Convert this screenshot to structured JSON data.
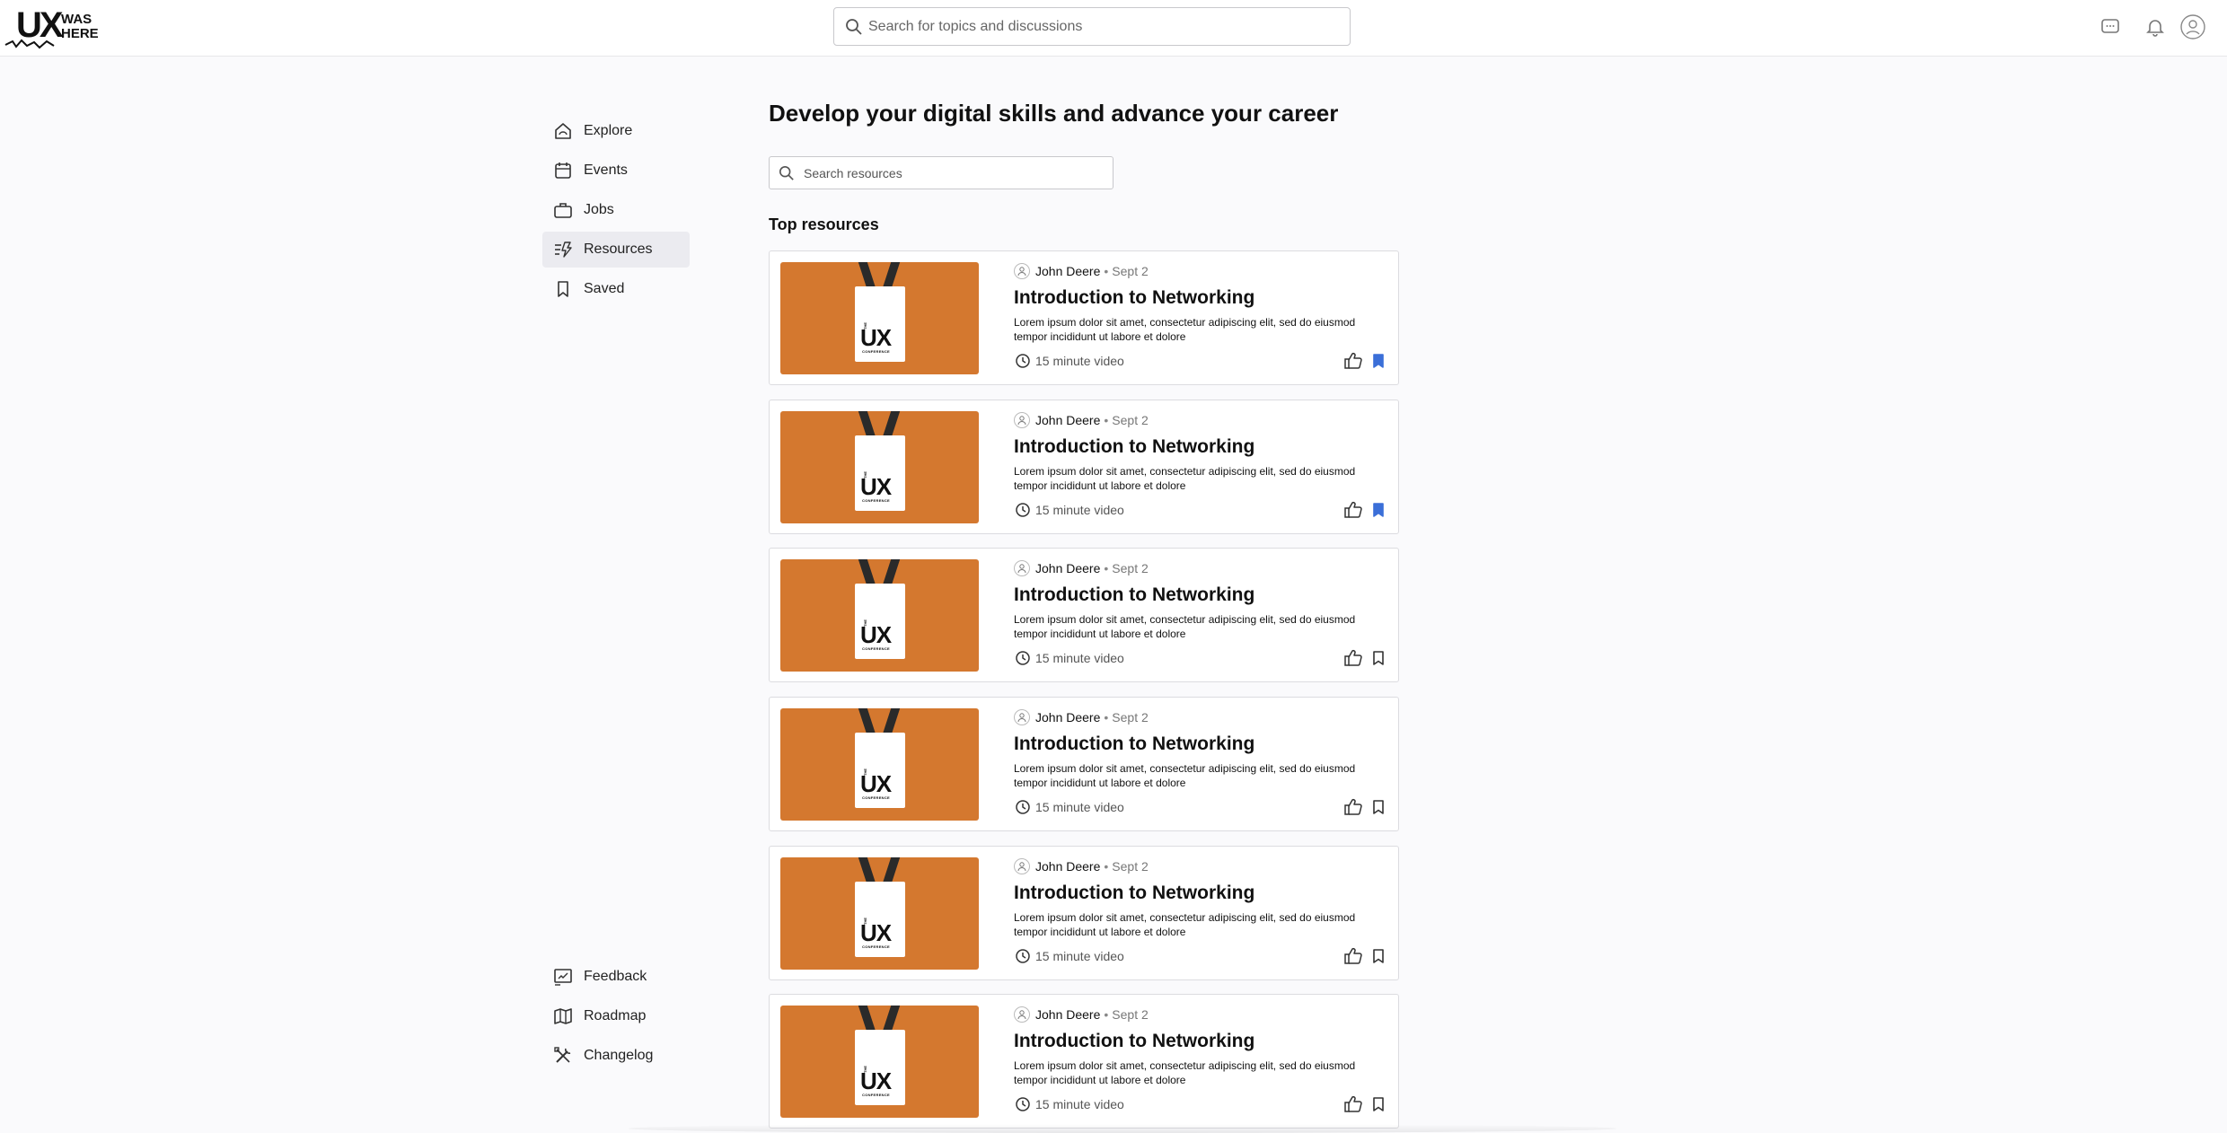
{
  "brand": {
    "logo_text_main": "UX",
    "logo_text_top": "WAS",
    "logo_text_bottom": "HERE"
  },
  "header": {
    "search_placeholder": "Search for topics and discussions",
    "icons": [
      "chat-icon",
      "bell-icon",
      "user-icon"
    ]
  },
  "sidebar": {
    "items": [
      {
        "label": "Explore",
        "icon": "home-icon"
      },
      {
        "label": "Events",
        "icon": "calendar-icon"
      },
      {
        "label": "Jobs",
        "icon": "briefcase-icon"
      },
      {
        "label": "Resources",
        "icon": "resources-icon",
        "active": true
      },
      {
        "label": "Saved",
        "icon": "bookmark-icon"
      }
    ],
    "bottom_items": [
      {
        "label": "Feedback",
        "icon": "feedback-icon"
      },
      {
        "label": "Roadmap",
        "icon": "map-icon"
      },
      {
        "label": "Changelog",
        "icon": "tools-icon"
      }
    ]
  },
  "main": {
    "title": "Develop your digital skills and advance your career",
    "search_placeholder": "Search resources",
    "section_title": "Top resources",
    "cards": [
      {
        "author": "John Deere",
        "date": "Sept 2",
        "title": "Introduction to Networking",
        "description": "Lorem ipsum dolor sit amet, consectetur adipiscing elit, sed do eiusmod tempor incididunt ut labore et dolore",
        "duration": "15 minute video",
        "saved": true,
        "thumb": {
          "top": "THE",
          "main": "UX",
          "bottom": "CONFERENCE"
        }
      },
      {
        "author": "John Deere",
        "date": "Sept 2",
        "title": "Introduction to Networking",
        "description": "Lorem ipsum dolor sit amet, consectetur adipiscing elit, sed do eiusmod tempor incididunt ut labore et dolore",
        "duration": "15 minute video",
        "saved": true,
        "thumb": {
          "top": "THE",
          "main": "UX",
          "bottom": "CONFERENCE"
        }
      },
      {
        "author": "John Deere",
        "date": "Sept 2",
        "title": "Introduction to Networking",
        "description": "Lorem ipsum dolor sit amet, consectetur adipiscing elit, sed do eiusmod tempor incididunt ut labore et dolore",
        "duration": "15 minute video",
        "saved": false,
        "thumb": {
          "top": "THE",
          "main": "UX",
          "bottom": "CONFERENCE"
        }
      },
      {
        "author": "John Deere",
        "date": "Sept 2",
        "title": "Introduction to Networking",
        "description": "Lorem ipsum dolor sit amet, consectetur adipiscing elit, sed do eiusmod tempor incididunt ut labore et dolore",
        "duration": "15 minute video",
        "saved": false,
        "thumb": {
          "top": "THE",
          "main": "UX",
          "bottom": "CONFERENCE"
        }
      },
      {
        "author": "John Deere",
        "date": "Sept 2",
        "title": "Introduction to Networking",
        "description": "Lorem ipsum dolor sit amet, consectetur adipiscing elit, sed do eiusmod tempor incididunt ut labore et dolore",
        "duration": "15 minute video",
        "saved": false,
        "thumb": {
          "top": "THE",
          "main": "UX",
          "bottom": "CONFERENCE"
        }
      },
      {
        "author": "John Deere",
        "date": "Sept 2",
        "title": "Introduction to Networking",
        "description": "Lorem ipsum dolor sit amet, consectetur adipiscing elit, sed do eiusmod tempor incididunt ut labore et dolore",
        "duration": "15 minute video",
        "saved": false,
        "thumb": {
          "top": "THE",
          "main": "UX",
          "bottom": "CONFERENCE"
        }
      }
    ]
  },
  "colors": {
    "accent": "#3b6fd8",
    "thumb_bg": "#d4782f",
    "active_nav_bg": "#ebebf0"
  }
}
